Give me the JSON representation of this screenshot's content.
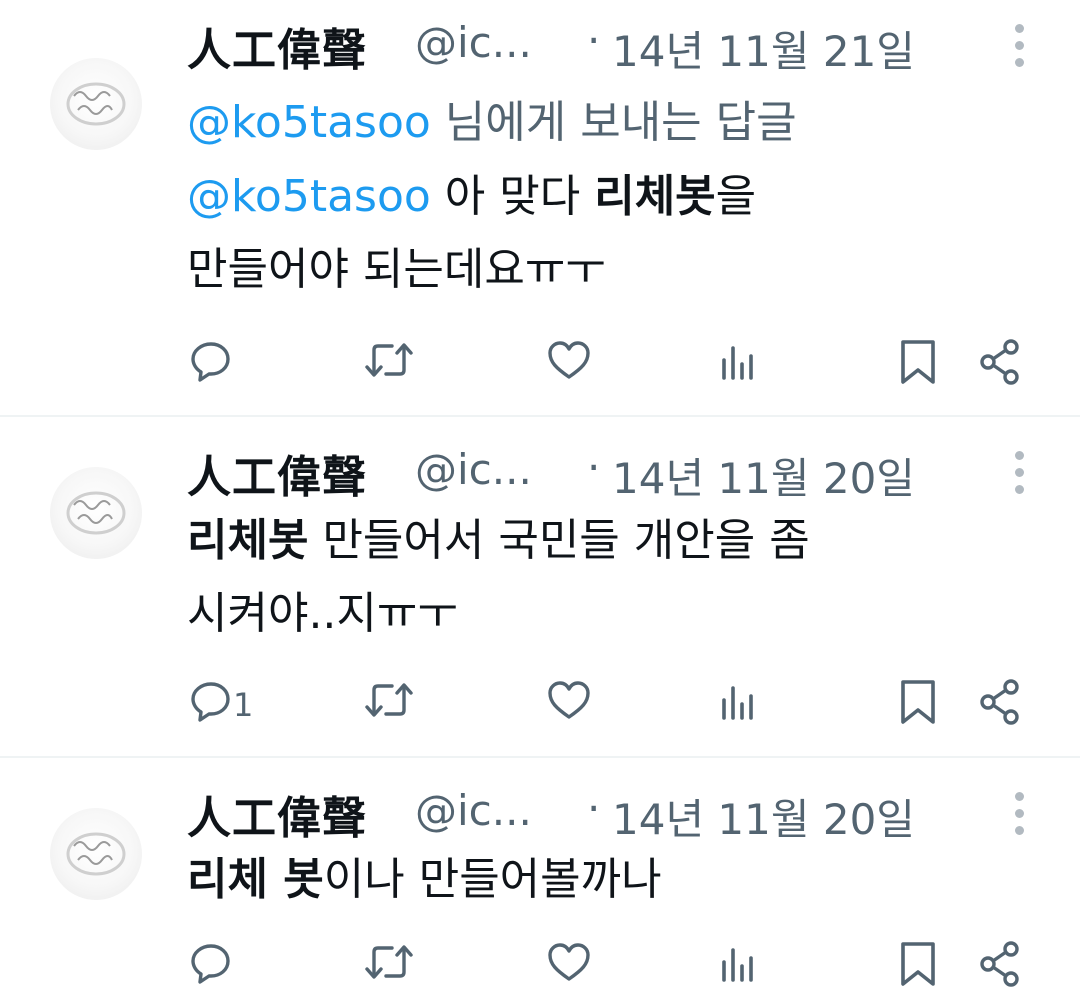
{
  "tweets": [
    {
      "name": "人工偉聲",
      "handle": "@ic...",
      "separator": "·",
      "date": "14년 11월 21일",
      "reply_to": {
        "mention": "@ko5tasoo",
        "suffix": " 님에게 보내는 답글"
      },
      "lines": [
        [
          {
            "t": "@ko5tasoo",
            "style": "mention"
          },
          {
            "t": " 아 맞다 ",
            "style": "normal"
          },
          {
            "t": "리체봇",
            "style": "bold"
          },
          {
            "t": "을",
            "style": "normal"
          }
        ],
        [
          {
            "t": "만들어야 되는데요ㅠㅜ",
            "style": "normal"
          }
        ]
      ],
      "reply_count": ""
    },
    {
      "name": "人工偉聲",
      "handle": "@ic...",
      "separator": "·",
      "date": "14년 11월 20일",
      "reply_to": null,
      "lines": [
        [
          {
            "t": "리체봇",
            "style": "bold"
          },
          {
            "t": " 만들어서 국민들 개안을 좀",
            "style": "normal"
          }
        ],
        [
          {
            "t": "시켜야..지ㅠㅜ",
            "style": "normal"
          }
        ]
      ],
      "reply_count": "1"
    },
    {
      "name": "人工偉聲",
      "handle": "@ic...",
      "separator": "·",
      "date": "14년 11월 20일",
      "reply_to": null,
      "lines": [
        [
          {
            "t": "리체 봇",
            "style": "bold"
          },
          {
            "t": "이나 만들어볼까나",
            "style": "normal"
          }
        ]
      ],
      "reply_count": ""
    }
  ],
  "icons": {
    "avatar": "ring-avatar-icon",
    "more": "more-options-icon",
    "reply": "reply-icon",
    "retweet": "retweet-icon",
    "like": "heart-icon",
    "views": "views-chart-icon",
    "bookmark": "bookmark-icon",
    "share": "share-icon"
  },
  "colors": {
    "text": "#0f1419",
    "secondary": "#536471",
    "link": "#1d9bf0",
    "divider": "#eff3f4",
    "icon": "#536471"
  }
}
